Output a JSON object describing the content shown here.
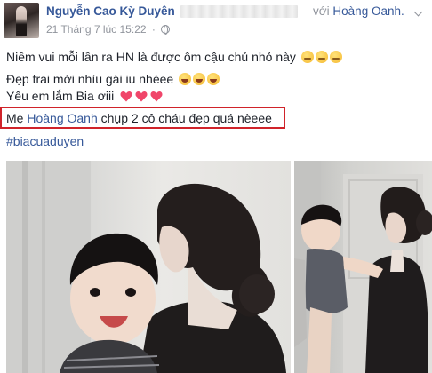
{
  "post": {
    "author_name": "Nguyễn Cao Kỳ Duyên",
    "with_prefix": "– với",
    "tagged_name": "Hoàng Oanh.",
    "timestamp": "21 Tháng 7 lúc 15:22",
    "separator": "·",
    "privacy_icon": "globe-icon",
    "menu_icon": "chevron-down-icon"
  },
  "content": {
    "line1": "Niềm vui mỗi lần ra HN là được ôm cậu chủ nhỏ này",
    "line1_emojis": [
      "angry-face",
      "angry-face",
      "angry-face"
    ],
    "line2": "Đẹp trai mới nhìu gái iu nhéee",
    "line2_emojis": [
      "rolling-laugh",
      "rolling-laugh",
      "rolling-laugh"
    ],
    "line3": "Yêu em lắm Bia ơiii",
    "line3_icons": [
      "heart",
      "heart",
      "heart"
    ],
    "line4_prefix": "Mẹ",
    "line4_mention": "Hoàng Oanh",
    "line4_suffix": "chụp 2 cô cháu đẹp quá nèeee",
    "hashtag": "#biacuaduyen"
  },
  "colors": {
    "link": "#365899",
    "meta": "#90949c",
    "text": "#1d2129",
    "highlight_border": "#d0232a",
    "heart": "#f0466a"
  },
  "photos": [
    {
      "name": "photo-woman-holding-baby-close"
    },
    {
      "name": "photo-woman-holding-baby-standing"
    }
  ]
}
